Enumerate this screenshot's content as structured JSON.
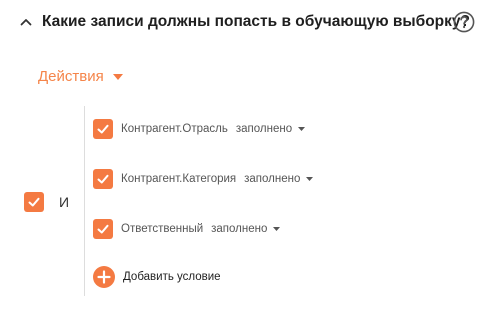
{
  "colors": {
    "accent": "#f47a42",
    "actions_text": "#f5854a",
    "title_text": "#1f1f1f",
    "secondary_text": "#555555",
    "divider": "#dddddd"
  },
  "header": {
    "collapse_icon": "chevron-up-icon",
    "title": "Какие записи должны попасть в обучающую выборку?",
    "help_icon": "help-circle-icon"
  },
  "actions": {
    "label": "Действия",
    "icon": "caret-down-icon"
  },
  "group": {
    "checked": true,
    "operator": "И",
    "conditions": [
      {
        "checked": true,
        "field": "Контрагент.Отрасль",
        "operator": "заполнено"
      },
      {
        "checked": true,
        "field": "Контрагент.Категория",
        "operator": "заполнено"
      },
      {
        "checked": true,
        "field": "Ответственный",
        "operator": "заполнено"
      }
    ],
    "add_condition": {
      "icon": "plus-icon",
      "label": "Добавить условие"
    }
  }
}
